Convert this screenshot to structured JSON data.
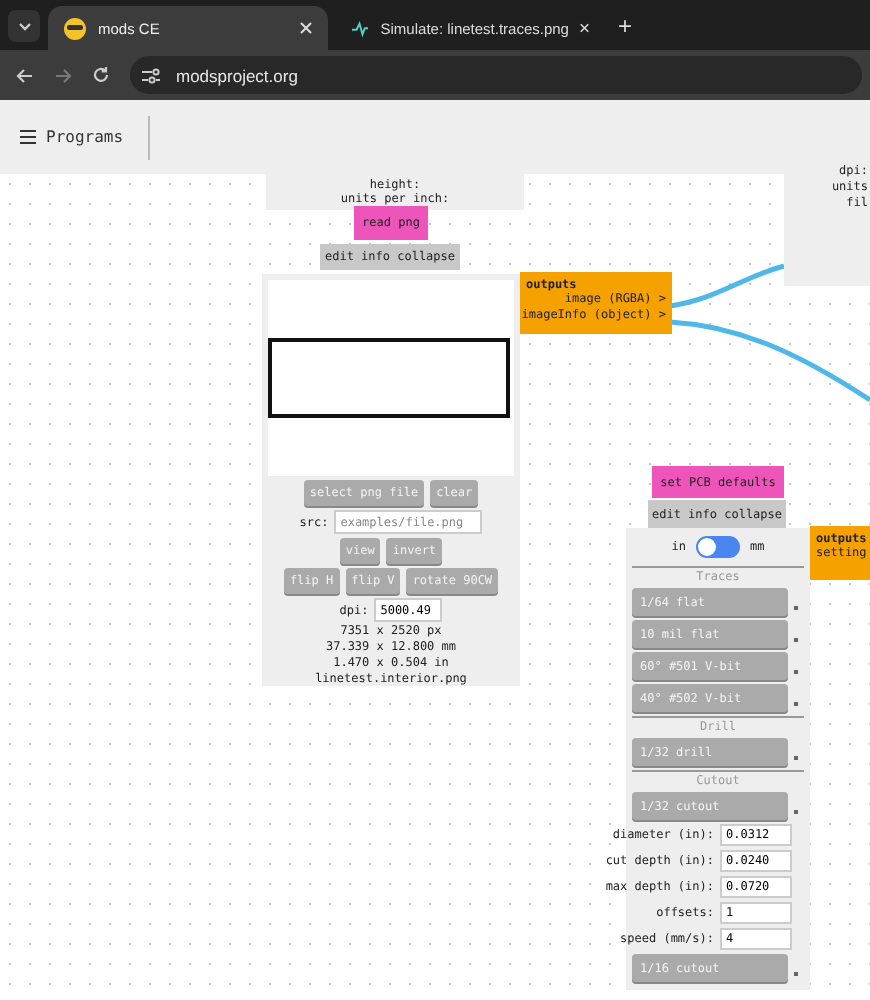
{
  "browser": {
    "tabs": [
      {
        "title": "mods CE",
        "selected": true
      },
      {
        "title": "Simulate: linetest.traces.png",
        "selected": false
      }
    ],
    "new_tab": "+",
    "address": "modsproject.org"
  },
  "toolbar": {
    "menu": "Programs"
  },
  "top_node": {
    "lines": [
      "height:",
      "units per inch:"
    ]
  },
  "read_png": {
    "title": "read png",
    "menu": "edit info collapse",
    "row1": [
      "select png file",
      "clear"
    ],
    "src_label": "src:",
    "src_placeholder": "examples/file.png",
    "row2": [
      "view",
      "invert"
    ],
    "row3": [
      "flip H",
      "flip V",
      "rotate 90CW"
    ],
    "dpi_label": "dpi:",
    "dpi_value": "5000.49",
    "info": [
      "7351 x 2520 px",
      "37.339 x 12.800 mm",
      "1.470 x 0.504 in",
      "linetest.interior.png"
    ],
    "outputs": {
      "title": "outputs",
      "ports": [
        "image (RGBA) >",
        "imageInfo (object) >"
      ]
    }
  },
  "partial_node": {
    "lines": [
      "dpi:",
      "units",
      "fil"
    ]
  },
  "pcb": {
    "title": "set PCB defaults",
    "menu": "edit info collapse",
    "units": {
      "left": "in",
      "right": "mm",
      "on": false
    },
    "sections": [
      {
        "title": "Traces",
        "items": [
          {
            "kind": "preset",
            "label": "1/64 flat"
          },
          {
            "kind": "preset",
            "label": "10 mil flat"
          },
          {
            "kind": "preset",
            "label": "60° #501 V-bit"
          },
          {
            "kind": "preset",
            "label": "40° #502 V-bit"
          }
        ]
      },
      {
        "title": "Drill",
        "items": [
          {
            "kind": "preset",
            "label": "1/32 drill"
          }
        ]
      },
      {
        "title": "Cutout",
        "items": [
          {
            "kind": "preset",
            "label": "1/32 cutout"
          },
          {
            "kind": "fields",
            "fields": [
              {
                "label": "diameter (in):",
                "value": "0.0312"
              },
              {
                "label": "cut depth (in):",
                "value": "0.0240"
              },
              {
                "label": "max depth (in):",
                "value": "0.0720"
              },
              {
                "label": "offsets:",
                "value": "1"
              },
              {
                "label": "speed (mm/s):",
                "value": "4"
              }
            ]
          },
          {
            "kind": "preset",
            "label": "1/16 cutout"
          }
        ]
      }
    ],
    "outputs": {
      "title": "outputs",
      "ports": [
        "setting"
      ]
    }
  }
}
